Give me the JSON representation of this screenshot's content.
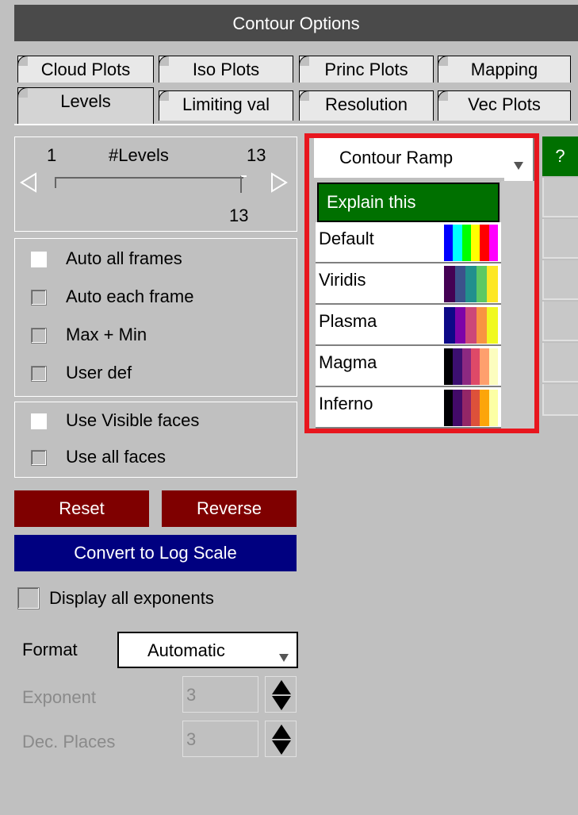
{
  "window": {
    "title": "Contour Options"
  },
  "tabs_row1": [
    "Cloud Plots",
    "Iso Plots",
    "Princ Plots",
    "Mapping"
  ],
  "tabs_row2": [
    "Levels",
    "Limiting val",
    "Resolution",
    "Vec Plots"
  ],
  "levels": {
    "min": "1",
    "label": "#Levels",
    "max": "13",
    "value": "13",
    "slider_fraction": 1.0
  },
  "auto_options": [
    {
      "label": "Auto all frames",
      "checked": true
    },
    {
      "label": "Auto each frame",
      "checked": false
    },
    {
      "label": "Max + Min",
      "checked": false
    },
    {
      "label": "User def",
      "checked": false
    }
  ],
  "face_options": [
    {
      "label": "Use Visible faces",
      "checked": true
    },
    {
      "label": "Use all faces",
      "checked": false
    }
  ],
  "buttons": {
    "reset": "Reset",
    "reverse": "Reverse",
    "log_scale": "Convert to Log Scale"
  },
  "display_exponents": {
    "label": "Display all exponents"
  },
  "format": {
    "label": "Format",
    "value": "Automatic"
  },
  "exponent": {
    "label": "Exponent",
    "value": "3"
  },
  "dec_places": {
    "label": "Dec. Places",
    "value": "3"
  },
  "ramp": {
    "header": "Contour Ramp",
    "help": "?",
    "explain": "Explain this",
    "items": [
      {
        "label": "Default",
        "colors": [
          "#0000ff",
          "#00ffff",
          "#00ff00",
          "#ffff00",
          "#ff0000",
          "#ff00ff"
        ]
      },
      {
        "label": "Viridis",
        "colors": [
          "#440154",
          "#3b528b",
          "#21908d",
          "#5dc963",
          "#fde725"
        ]
      },
      {
        "label": "Plasma",
        "colors": [
          "#0d0887",
          "#7e03a8",
          "#cc4778",
          "#f89441",
          "#f0f921"
        ]
      },
      {
        "label": "Magma",
        "colors": [
          "#000004",
          "#3b0f70",
          "#8c2981",
          "#de4968",
          "#fe9f6d",
          "#fcfdbf"
        ]
      },
      {
        "label": "Inferno",
        "colors": [
          "#000004",
          "#420a68",
          "#932667",
          "#dd513a",
          "#fca50a",
          "#fcffa4"
        ]
      }
    ]
  },
  "colors": {
    "titlebar": "#4a4a4a",
    "reset_btn": "#7f0000",
    "log_btn": "#000080",
    "explain_btn": "#007000",
    "highlight_border": "#e8161e"
  }
}
